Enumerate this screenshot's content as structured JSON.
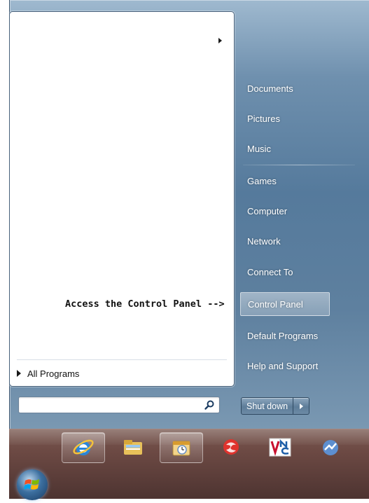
{
  "left_pane": {
    "all_programs_label": "All Programs",
    "search": {
      "value": "",
      "placeholder": ""
    }
  },
  "annotation": {
    "text": "Access the Control Panel -->"
  },
  "right_pane": {
    "items": [
      {
        "label": "Documents"
      },
      {
        "label": "Pictures"
      },
      {
        "label": "Music"
      },
      {
        "label": "Games"
      },
      {
        "label": "Computer"
      },
      {
        "label": "Network"
      },
      {
        "label": "Connect To"
      },
      {
        "label": "Control Panel",
        "highlighted": true
      },
      {
        "label": "Default Programs"
      },
      {
        "label": "Help and Support"
      }
    ],
    "shutdown_label": "Shut down"
  },
  "taskbar": {
    "icons": [
      {
        "name": "start-orb-icon"
      },
      {
        "name": "internet-explorer-icon"
      },
      {
        "name": "file-explorer-icon"
      },
      {
        "name": "outlook-calendar-icon"
      },
      {
        "name": "red-app-icon"
      },
      {
        "name": "vnc-icon"
      },
      {
        "name": "blue-app-icon"
      }
    ]
  },
  "colors": {
    "menu_glass": "#557a9c",
    "taskbar": "#5b3d39",
    "highlight": "#ffffff"
  }
}
